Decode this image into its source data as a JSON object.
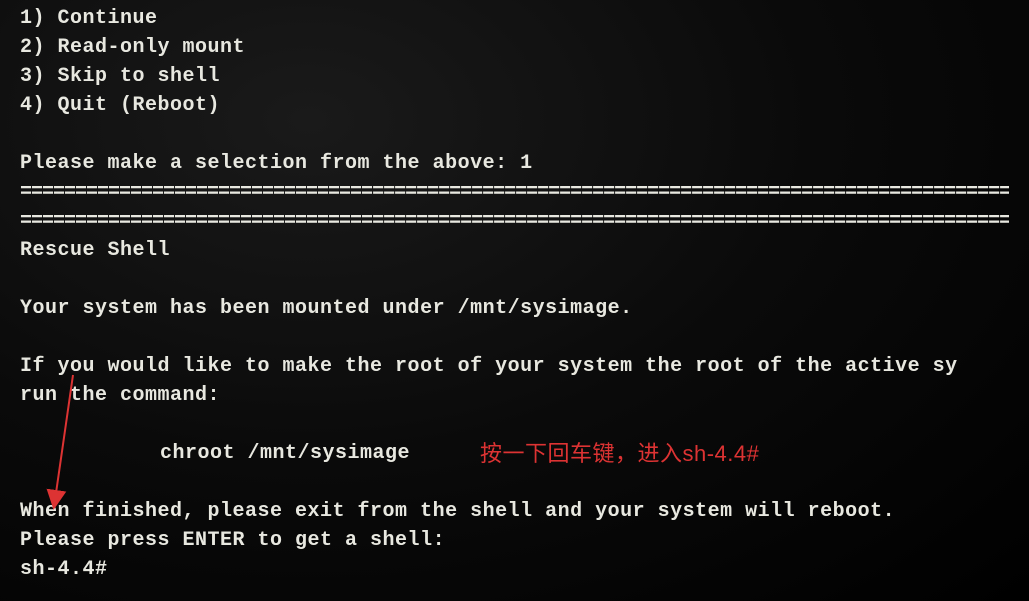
{
  "menu": {
    "option1": "1) Continue",
    "option2": "2) Read-only mount",
    "option3": "3) Skip to shell",
    "option4": "4) Quit (Reboot)"
  },
  "prompt": {
    "selection_text": "Please make a selection from the above: ",
    "selection_input": "1"
  },
  "separator": "================================================================================================",
  "rescue": {
    "title": "Rescue Shell",
    "mounted_msg": "Your system has been mounted under /mnt/sysimage.",
    "instruction1": "If you would like to make the root of your system the root of the active sy",
    "instruction2": "run the command:",
    "chroot_cmd": "chroot /mnt/sysimage",
    "finished_msg": "When finished, please exit from the shell and your system will reboot.",
    "enter_prompt": "Please press ENTER to get a shell:",
    "shell_prompt": "sh-4.4#"
  },
  "annotation": {
    "text": "按一下回车键，进入sh-4.4#"
  }
}
